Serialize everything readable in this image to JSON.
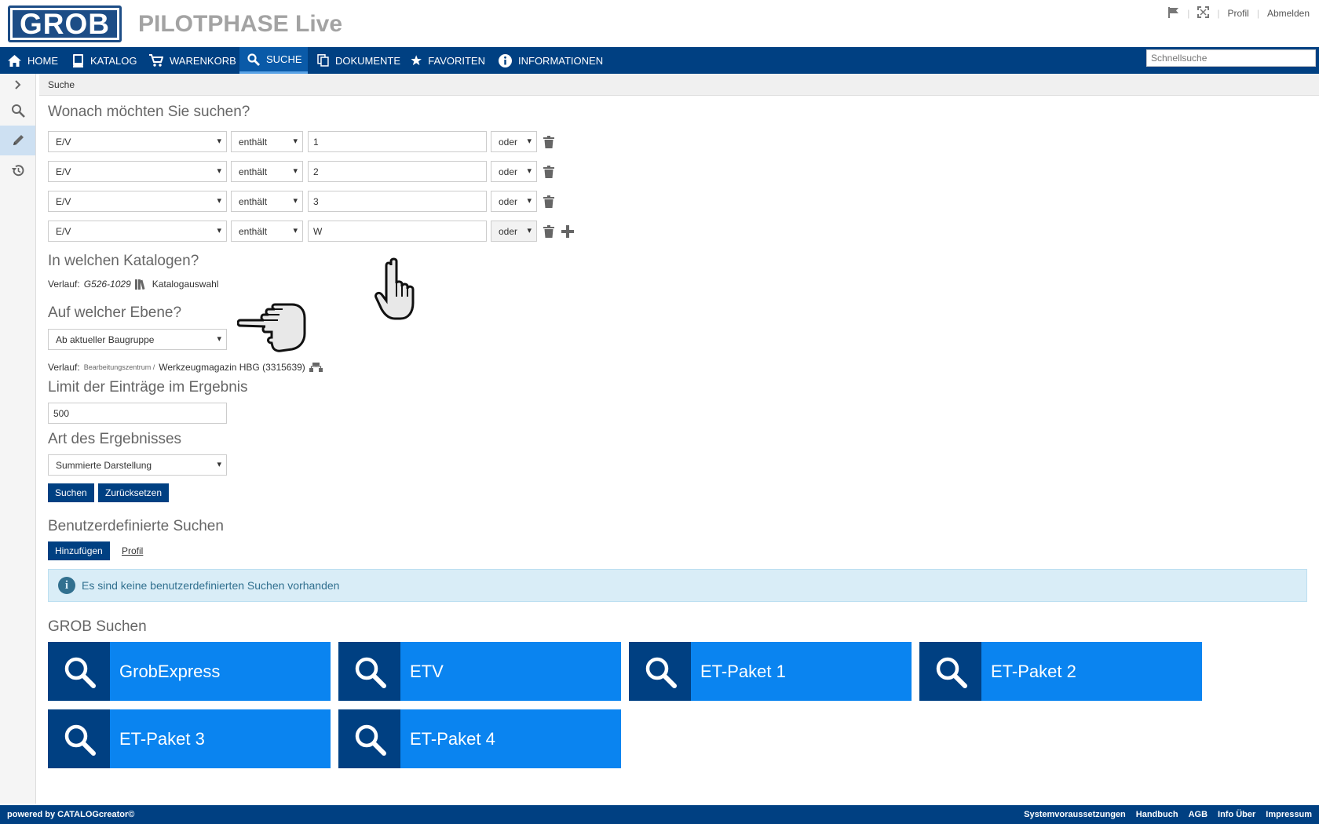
{
  "header": {
    "logo_text": "GROB",
    "app_title": "PILOTPHASE Live",
    "links": {
      "profile": "Profil",
      "logout": "Abmelden"
    },
    "icons": [
      "flag-icon",
      "fullscreen-icon"
    ]
  },
  "nav": {
    "items": [
      {
        "label": "HOME",
        "icon": "home-icon"
      },
      {
        "label": "KATALOG",
        "icon": "book-icon"
      },
      {
        "label": "WARENKORB",
        "icon": "cart-icon"
      },
      {
        "label": "SUCHE",
        "icon": "search-icon",
        "active": true
      },
      {
        "label": "DOKUMENTE",
        "icon": "documents-icon"
      },
      {
        "label": "FAVORITEN",
        "icon": "star-icon"
      },
      {
        "label": "INFORMATIONEN",
        "icon": "info-icon"
      }
    ],
    "quick_search_placeholder": "Schnellsuche"
  },
  "sidebar": {
    "icons": [
      "chevron-right-icon",
      "search-icon",
      "pencil-icon",
      "history-icon"
    ]
  },
  "breadcrumb": "Suche",
  "search": {
    "heading": "Wonach möchten Sie suchen?",
    "rows": [
      {
        "field": "E/V",
        "operator": "enthält",
        "value": "1",
        "logic": "oder"
      },
      {
        "field": "E/V",
        "operator": "enthält",
        "value": "2",
        "logic": "oder"
      },
      {
        "field": "E/V",
        "operator": "enthält",
        "value": "3",
        "logic": "oder"
      },
      {
        "field": "E/V",
        "operator": "enthält",
        "value": "W",
        "logic": "oder"
      }
    ]
  },
  "catalogs": {
    "heading": "In welchen Katalogen?",
    "path_label": "Verlauf:",
    "path_value": "G526-1029",
    "selection_link": "Katalogauswahl"
  },
  "level": {
    "heading": "Auf welcher Ebene?",
    "selected": "Ab aktueller Baugruppe",
    "path_label": "Verlauf:",
    "path_small": "Bearbeitungszentrum /",
    "path_value": "Werkzeugmagazin HBG (3315639)"
  },
  "limit": {
    "heading": "Limit der Einträge im Ergebnis",
    "value": "500"
  },
  "result_type": {
    "heading": "Art des Ergebnisses",
    "selected": "Summierte Darstellung"
  },
  "actions": {
    "search": "Suchen",
    "reset": "Zurücksetzen"
  },
  "custom_searches": {
    "heading": "Benutzerdefinierte Suchen",
    "add": "Hinzufügen",
    "profile": "Profil",
    "info": "Es sind keine benutzerdefinierten Suchen vorhanden"
  },
  "grob_searches": {
    "heading": "GROB Suchen",
    "tiles": [
      "GrobExpress",
      "ETV",
      "ET-Paket 1",
      "ET-Paket 2",
      "ET-Paket 3",
      "ET-Paket 4"
    ]
  },
  "footer": {
    "powered": "powered by CATALOGcreator©",
    "links": [
      "Systemvoraussetzungen",
      "Handbuch",
      "AGB",
      "Info Über",
      "Impressum"
    ]
  },
  "colors": {
    "nav": "#004082",
    "tile": "#0a84f0",
    "tile_icon": "#004082",
    "info_bg": "#d9edf7"
  }
}
